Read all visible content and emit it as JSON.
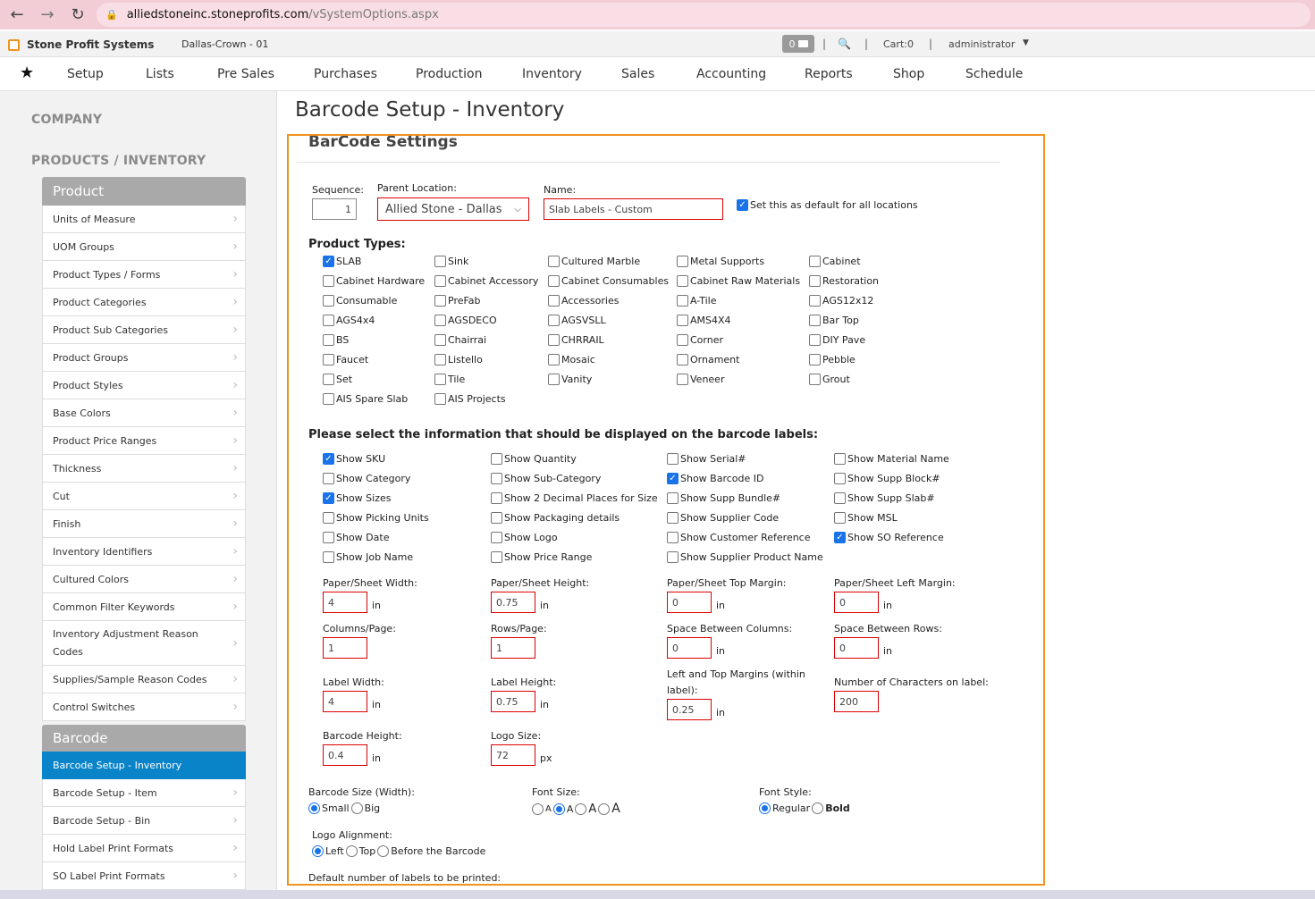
{
  "browser": {
    "url_domain": "alliedstoneinc.stoneprofits.com",
    "url_path": "/vSystemOptions.aspx"
  },
  "header": {
    "app_name": "Stone Profit Systems",
    "location": "Dallas-Crown - 01",
    "mail_count": "0",
    "cart": "Cart:0",
    "user": "administrator"
  },
  "nav": [
    "Setup",
    "Lists",
    "Pre Sales",
    "Purchases",
    "Production",
    "Inventory",
    "Sales",
    "Accounting",
    "Reports",
    "Shop",
    "Schedule"
  ],
  "sidebar": {
    "company": "COMPANY",
    "products": "PRODUCTS / INVENTORY",
    "product_group": {
      "title": "Product",
      "items": [
        "Units of Measure",
        "UOM Groups",
        "Product Types / Forms",
        "Product Categories",
        "Product Sub Categories",
        "Product Groups",
        "Product Styles",
        "Base Colors",
        "Product Price Ranges",
        "Thickness",
        "Cut",
        "Finish",
        "Inventory Identifiers",
        "Cultured Colors",
        "Common Filter Keywords",
        "Inventory Adjustment Reason Codes",
        "Supplies/Sample Reason Codes",
        "Control Switches"
      ]
    },
    "barcode_group": {
      "title": "Barcode",
      "items": [
        "Barcode Setup - Inventory",
        "Barcode Setup - Item",
        "Barcode Setup - Bin",
        "Hold Label Print Formats",
        "SO Label Print Formats"
      ]
    }
  },
  "page": {
    "title": "Barcode Setup - Inventory",
    "panel_title": "BarCode Settings"
  },
  "form": {
    "sequence_label": "Sequence:",
    "sequence_value": "1",
    "parent_location_label": "Parent Location:",
    "parent_location_value": "Allied Stone - Dallas",
    "name_label": "Name:",
    "name_value": "Slab Labels - Custom",
    "default_label": "Set this as default for all locations",
    "product_types_title": "Product Types:",
    "product_types": [
      [
        "SLAB",
        "Sink",
        "Cultured Marble",
        "Metal Supports",
        "Cabinet"
      ],
      [
        "Cabinet Hardware",
        "Cabinet Accessory",
        "Cabinet Consumables",
        "Cabinet Raw Materials",
        "Restoration"
      ],
      [
        "Consumable",
        "PreFab",
        "Accessories",
        "A-Tile",
        "AGS12x12"
      ],
      [
        "AGS4x4",
        "AGSDECO",
        "AGSVSLL",
        "AMS4X4",
        "Bar Top"
      ],
      [
        "BS",
        "Chairrai",
        "CHRRAIL",
        "Corner",
        "DIY Pave"
      ],
      [
        "Faucet",
        "Listello",
        "Mosaic",
        "Ornament",
        "Pebble"
      ],
      [
        "Set",
        "Tile",
        "Vanity",
        "Veneer",
        "Grout"
      ],
      [
        "AIS Spare Slab",
        "AIS Projects"
      ]
    ],
    "display_title": "Please select the information that should be displayed on the barcode labels:",
    "display_options": [
      [
        "Show SKU",
        "Show Quantity",
        "Show Serial#",
        "Show Material Name"
      ],
      [
        "Show Category",
        "Show Sub-Category",
        "Show Barcode ID",
        "Show Supp Block#"
      ],
      [
        "Show Sizes",
        "Show 2 Decimal Places for Size",
        "Show Supp Bundle#",
        "Show Supp Slab#"
      ],
      [
        "Show Picking Units",
        "Show Packaging details",
        "Show Supplier Code",
        "Show MSL"
      ],
      [
        "Show Date",
        "Show Logo",
        "Show Customer Reference",
        "Show SO Reference"
      ],
      [
        "Show Job Name",
        "Show Price Range",
        "Show Supplier Product Name"
      ]
    ],
    "dims": {
      "paper_width_label": "Paper/Sheet Width:",
      "paper_width": "4",
      "paper_height_label": "Paper/Sheet Height:",
      "paper_height": "0.75",
      "top_margin_label": "Paper/Sheet Top Margin:",
      "top_margin": "0",
      "left_margin_label": "Paper/Sheet Left Margin:",
      "left_margin": "0",
      "columns_label": "Columns/Page:",
      "columns": "1",
      "rows_label": "Rows/Page:",
      "rows": "1",
      "space_cols_label": "Space Between Columns:",
      "space_cols": "0",
      "space_rows_label": "Space Between Rows:",
      "space_rows": "0",
      "label_width_label": "Label Width:",
      "label_width": "4",
      "label_height_label": "Label Height:",
      "label_height": "0.75",
      "lt_margins_label_1": "Left and Top Margins (within",
      "lt_margins_label_2": "label):",
      "lt_margins": "0.25",
      "num_chars_label": "Number of Characters on label:",
      "num_chars": "200",
      "barcode_height_label": "Barcode Height:",
      "barcode_height": "0.4",
      "logo_size_label": "Logo Size:",
      "logo_size": "72",
      "unit_in": "in",
      "unit_px": "px"
    },
    "barcode_size_label": "Barcode Size (Width):",
    "barcode_size_small": "Small",
    "barcode_size_big": "Big",
    "font_size_label": "Font Size:",
    "font_size_options": [
      "A",
      "A",
      "A",
      "A"
    ],
    "font_style_label": "Font Style:",
    "font_style_regular": "Regular",
    "font_style_bold": "Bold",
    "logo_alignment_label": "Logo Alignment:",
    "logo_left": "Left",
    "logo_top": "Top",
    "logo_before": "Before the Barcode",
    "default_labels_label": "Default number of labels to be printed:"
  }
}
